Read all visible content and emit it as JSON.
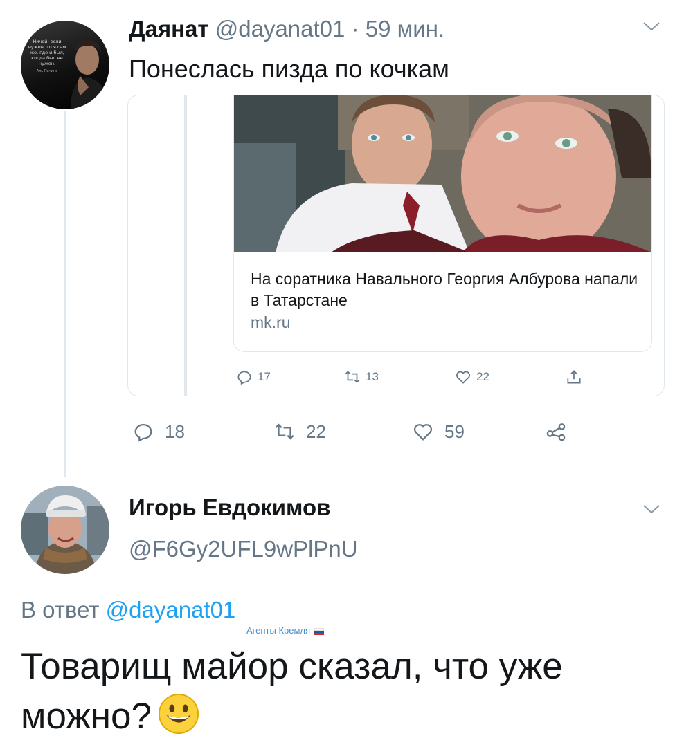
{
  "colors": {
    "text_primary": "#14171a",
    "text_secondary": "#657786",
    "link": "#1da1f2",
    "border": "#e1e8ed",
    "watermark": "#4a90c9"
  },
  "tweet1": {
    "name": "Даянат",
    "handle": "@dayanat01",
    "separator": "·",
    "time": "59 мин.",
    "text": "Понеслась пизда по кочкам",
    "avatar_quote": "Ничей, если нужен, то я сам же, где и был, когда был не нужен.",
    "avatar_quote_author": "Аль Пачино",
    "quoted": {
      "link_title": "На соратника Навального Георгия Албурова напали в Татарстане",
      "link_domain": "mk.ru",
      "actions": {
        "replies": "17",
        "retweets": "13",
        "likes": "22"
      }
    },
    "actions": {
      "replies": "18",
      "retweets": "22",
      "likes": "59"
    }
  },
  "tweet2": {
    "name": "Игорь Евдокимов",
    "handle": "@F6Gy2UFL9wPlPnU",
    "reply_prefix": "В ответ",
    "reply_mention": "@dayanat01",
    "text": "Товарищ майор сказал, что уже можно?"
  },
  "watermark": "Агенты Кремля",
  "icons": {
    "reply": "reply-icon",
    "retweet": "retweet-icon",
    "like": "heart-icon",
    "share": "share-icon",
    "chevron": "chevron-down-icon",
    "emoji": "grinning-face-emoji"
  }
}
